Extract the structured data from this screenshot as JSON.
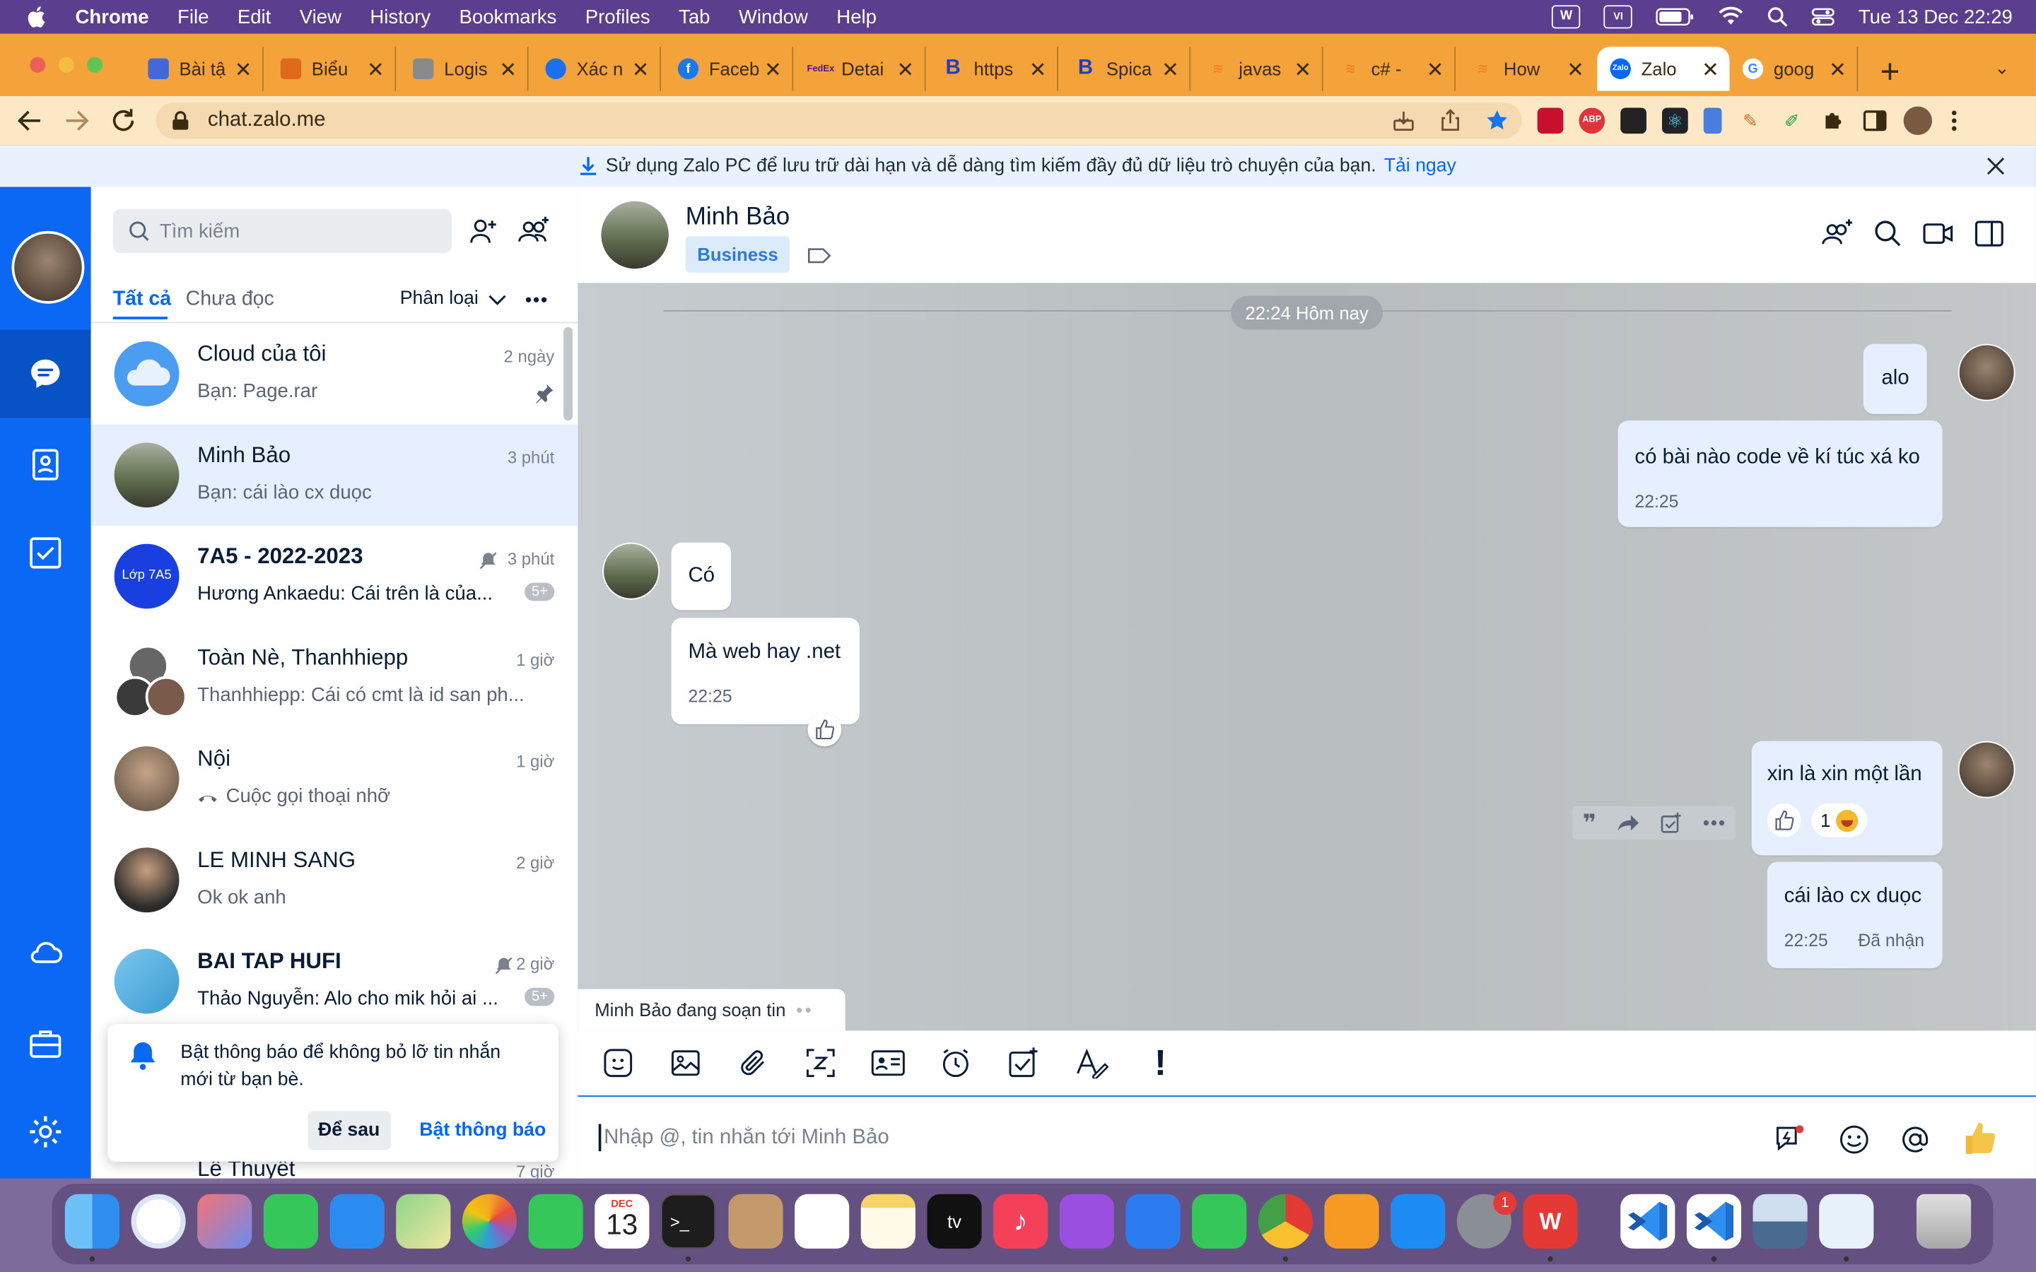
{
  "menubar": {
    "app": "Chrome",
    "items": [
      "File",
      "Edit",
      "View",
      "History",
      "Bookmarks",
      "Profiles",
      "Tab",
      "Window",
      "Help"
    ],
    "clock": "Tue 13 Dec  22:29"
  },
  "tabs": [
    {
      "title": "Bài tậ",
      "fav_color": "#3f6ad8"
    },
    {
      "title": "Biểu",
      "fav_color": "#e06a1b"
    },
    {
      "title": "Logis",
      "fav_color": "#8a8a8a"
    },
    {
      "title": "Xác n",
      "fav_color": "#1d6ff2"
    },
    {
      "title": "Faceb",
      "fav_color": "#1877f2"
    },
    {
      "title": "Detai",
      "fav_color": "#4d148c"
    },
    {
      "title": "https",
      "fav_color": "#1e3dcc"
    },
    {
      "title": "Spica",
      "fav_color": "#1e3dcc"
    },
    {
      "title": "javas",
      "fav_color": "#f48024"
    },
    {
      "title": "c# -",
      "fav_color": "#f48024"
    },
    {
      "title": "How",
      "fav_color": "#f48024"
    },
    {
      "title": "Zalo",
      "fav_color": "#0068ff"
    },
    {
      "title": "goog",
      "fav_color": "#4285f4"
    }
  ],
  "address": {
    "url": "chat.zalo.me"
  },
  "banner": {
    "text": "Sử dụng Zalo PC để lưu trữ dài hạn và dễ dàng tìm kiếm đầy đủ dữ liệu trò chuyện của bạn.",
    "link": "Tải ngay"
  },
  "sidebar": {
    "search_placeholder": "Tìm kiếm",
    "filter_all": "Tất cả",
    "filter_unread": "Chưa đọc",
    "classify": "Phân loại",
    "conversations": [
      {
        "name": "Cloud của tôi",
        "msg": "Bạn:  Page.rar",
        "time": "2 ngày",
        "avatar_color": "#4a9df0"
      },
      {
        "name": "Minh Bảo",
        "msg": "Bạn: cái lào cx duọc",
        "time": "3 phút",
        "avatar_color": "#6b7a5a"
      },
      {
        "name": "7A5 - 2022-2023",
        "msg": "Hương Ankaedu: Cái trên là của...",
        "time": "3 phút",
        "avatar_color": "#1a3fe0",
        "avatar_text": "Lớp 7A5",
        "badge": "5+"
      },
      {
        "name": "Toàn Nè, Thanhhiepp",
        "msg": "Thanhhiepp: Cái có cmt là id san ph...",
        "time": "1 giờ",
        "avatar_color": "#555"
      },
      {
        "name": "Nội",
        "msg": "Cuộc gọi thoại nhỡ",
        "time": "1 giờ",
        "avatar_color": "#8a7a6a"
      },
      {
        "name": "LE MINH SANG",
        "msg": "Ok ok anh",
        "time": "2 giờ",
        "avatar_color": "#3a3a3a"
      },
      {
        "name": "BAI TAP HUFI",
        "msg": "Thảo Nguyễn: Alo cho mik hỏi ai ...",
        "time": "2 giờ",
        "avatar_color": "#4ab0e0",
        "badge": "5+"
      },
      {
        "name": "Lê Thuyết",
        "msg": "",
        "time": "7 giờ",
        "avatar_color": "#999"
      }
    ],
    "notification": {
      "text": "Bật thông báo để không bỏ lỡ tin nhắn mới từ bạn bè.",
      "later": "Để sau",
      "enable": "Bật thông báo"
    }
  },
  "chat": {
    "name": "Minh Bảo",
    "tag": "Business",
    "date_divider": "22:24 Hôm nay",
    "messages": {
      "m1": "alo",
      "m2": "có bài nào code về kí túc xá ko",
      "m2_time": "22:25",
      "r1": "Có",
      "r2": "Mà web hay .net",
      "r2_time": "22:25",
      "m3": "xin là xin một lần",
      "m3_reaction_count": "1",
      "m4": "cái lào cx duọc",
      "m4_time": "22:25",
      "m4_status": "Đã nhận"
    },
    "typing": "Minh Bảo đang soạn tin",
    "input_placeholder": "Nhập @, tin nhắn tới Minh Bảo"
  },
  "dock": {
    "calendar_month": "DEC",
    "calendar_day": "13",
    "settings_badge": "1"
  }
}
